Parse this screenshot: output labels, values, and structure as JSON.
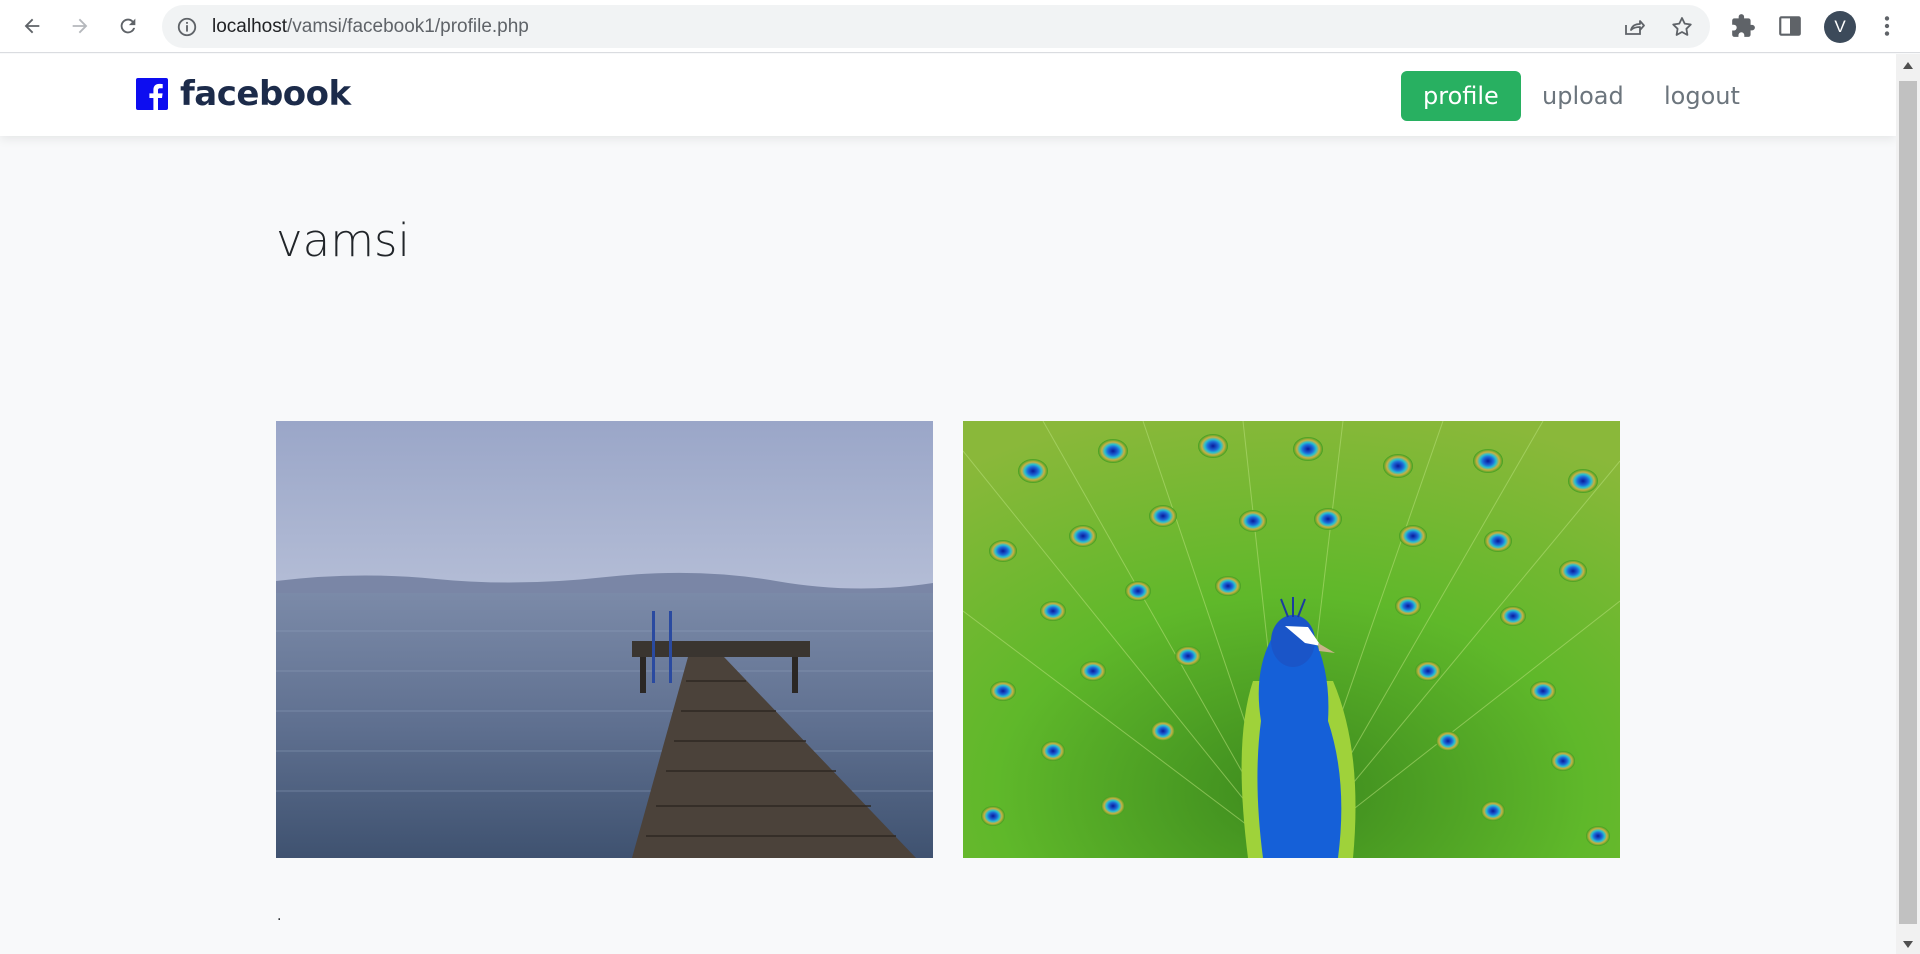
{
  "browser": {
    "url_host": "localhost",
    "url_path": "/vamsi/facebook1/profile.php",
    "profile_initial": "V"
  },
  "navbar": {
    "brand": "facebook",
    "links": [
      {
        "label": "profile",
        "active": true
      },
      {
        "label": "upload",
        "active": false
      },
      {
        "label": "logout",
        "active": false
      }
    ],
    "active_color": "#28b061"
  },
  "profile": {
    "username": "vamsi"
  },
  "photos": [
    {
      "subject": "wooden pier on lake"
    },
    {
      "subject": "peacock with fanned feathers"
    }
  ],
  "footer": {
    "text": "."
  }
}
